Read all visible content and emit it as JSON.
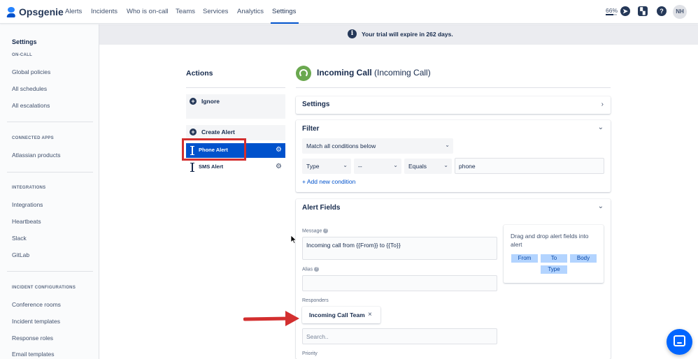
{
  "topnav": {
    "brand": "Opsgenie",
    "items": [
      "Alerts",
      "Incidents",
      "Who is on-call",
      "Teams",
      "Services",
      "Analytics",
      "Settings"
    ],
    "active": "Settings",
    "zoom": "66%",
    "zoom_level": 0.66,
    "avatar": "NH",
    "icons": [
      "compass-icon",
      "bookmark-icon",
      "help-icon"
    ]
  },
  "sidebar": {
    "title": "Settings",
    "sections": [
      {
        "heading": "ON-CALL",
        "items": [
          "Global policies",
          "All schedules",
          "All escalations"
        ]
      },
      {
        "heading": "CONNECTED APPS",
        "items": [
          "Atlassian products"
        ]
      },
      {
        "heading": "INTEGRATIONS",
        "items": [
          "Integrations",
          "Heartbeats",
          "Slack",
          "GitLab"
        ]
      },
      {
        "heading": "INCIDENT CONFIGURATIONS",
        "items": [
          "Conference rooms",
          "Incident templates",
          "Response roles",
          "Email templates"
        ]
      }
    ]
  },
  "banner": {
    "text": "Your trial will expire in 262 days."
  },
  "actions": {
    "title": "Actions",
    "ignore": "Ignore",
    "create_alert": "Create Alert",
    "rules": [
      {
        "label": "Phone Alert",
        "selected": true
      },
      {
        "label": "SMS Alert",
        "selected": false
      }
    ]
  },
  "integration": {
    "name": "Incoming Call",
    "type": "(Incoming Call)"
  },
  "settings_card": {
    "title": "Settings"
  },
  "filter": {
    "title": "Filter",
    "match": "Match all conditions below",
    "condition": {
      "field": "Type",
      "not": "--",
      "operator": "Equals",
      "value": "phone"
    },
    "add_condition": "+ Add new condition"
  },
  "alert_fields": {
    "title": "Alert Fields",
    "message_label": "Message",
    "message_value": "Incoming call from {{From}} to {{To}}",
    "alias_label": "Alias",
    "alias_value": "",
    "responders_label": "Responders",
    "responder": "Incoming Call Team",
    "responder_search_placeholder": "Search..",
    "priority_label": "Priority",
    "drag_hint": "Drag and drop alert fields into alert",
    "chips": [
      "From",
      "To",
      "Body",
      "Type"
    ]
  },
  "colors": {
    "primary": "#0052cc",
    "annotation_red": "#d32f2f",
    "chat": "#0065ff"
  }
}
